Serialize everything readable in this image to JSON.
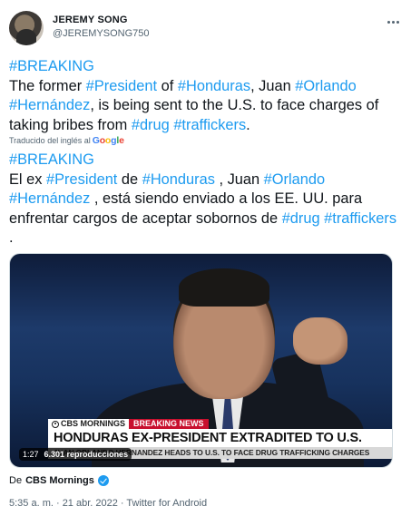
{
  "header": {
    "name": "JEREMY SONG",
    "handle": "@JEREMYSONG750"
  },
  "tweet": {
    "segments": [
      {
        "text": "#BREAKING",
        "tag": true
      },
      {
        "text": "\nThe former ",
        "tag": false
      },
      {
        "text": "#President",
        "tag": true
      },
      {
        "text": " of ",
        "tag": false
      },
      {
        "text": "#Honduras",
        "tag": true
      },
      {
        "text": ", Juan ",
        "tag": false
      },
      {
        "text": "#Orlando",
        "tag": true
      },
      {
        "text": " ",
        "tag": false
      },
      {
        "text": "#Hernández",
        "tag": true
      },
      {
        "text": ", is being sent to the U.S. to face charges of taking bribes from ",
        "tag": false
      },
      {
        "text": "#drug",
        "tag": true
      },
      {
        "text": " ",
        "tag": false
      },
      {
        "text": "#traffickers",
        "tag": true
      },
      {
        "text": ".",
        "tag": false
      }
    ]
  },
  "translation": {
    "note": "Traducido del inglés al",
    "provider": "Google",
    "segments": [
      {
        "text": "#BREAKING",
        "tag": true
      },
      {
        "text": "\n El ex ",
        "tag": false
      },
      {
        "text": "#President",
        "tag": true
      },
      {
        "text": " de ",
        "tag": false
      },
      {
        "text": "#Honduras",
        "tag": true
      },
      {
        "text": " , Juan ",
        "tag": false
      },
      {
        "text": "#Orlando",
        "tag": true
      },
      {
        "text": " ",
        "tag": false
      },
      {
        "text": "#Hernández",
        "tag": true
      },
      {
        "text": " , está siendo enviado a los EE. UU. para enfrentar cargos de aceptar sobornos de ",
        "tag": false
      },
      {
        "text": "#drug",
        "tag": true
      },
      {
        "text": " ",
        "tag": false
      },
      {
        "text": "#traffickers",
        "tag": true
      },
      {
        "text": " .",
        "tag": false
      }
    ]
  },
  "media": {
    "network": "CBS MORNINGS",
    "breaking": "BREAKING NEWS",
    "headline": "HONDURAS EX-PRESIDENT EXTRADITED TO U.S.",
    "subheadline": "JUAN ORLANDO HERNANDEZ HEADS TO U.S. TO FACE DRUG TRAFFICKING CHARGES",
    "duration": "1:27",
    "views": "6.301 reproducciones"
  },
  "source": {
    "prefix": "De",
    "name": "CBS Mornings"
  },
  "meta": {
    "timestamp": "5:35 a. m. · 21 abr. 2022 · Twitter for Android"
  },
  "colors": {
    "link": "#1d9bf0",
    "breaking_red": "#c8102e",
    "muted": "#536471"
  }
}
